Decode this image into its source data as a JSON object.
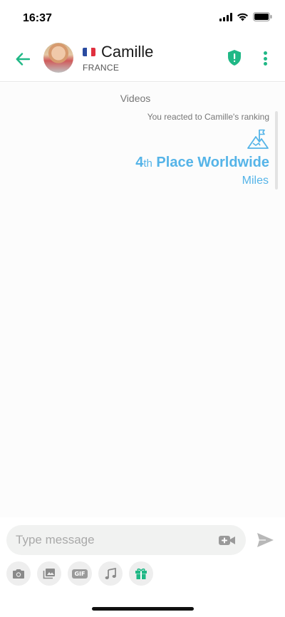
{
  "status_bar": {
    "time": "16:37",
    "icons": [
      "cellular-signal-icon",
      "wifi-icon",
      "battery-icon"
    ]
  },
  "header": {
    "back_icon": "arrow-left-icon",
    "contact_name": "Camille",
    "country": "FRANCE",
    "flag": "france-flag",
    "actions": [
      "shield-icon",
      "more-vertical-icon"
    ]
  },
  "chat": {
    "section_label": "Videos",
    "reaction_note": "You reacted to Camille's ranking",
    "ranking": {
      "icon": "mountain-flag-icon",
      "position_number": "4",
      "position_suffix": "th",
      "position_text": " Place Worldwide",
      "unit": "Miles"
    }
  },
  "composer": {
    "placeholder": "Type message",
    "value": "",
    "video_icon": "video-call-icon",
    "send_icon": "send-icon",
    "tools": [
      {
        "icon": "camera-icon"
      },
      {
        "icon": "gallery-icon"
      },
      {
        "icon": "gif-icon",
        "label": "GIF"
      },
      {
        "icon": "music-note-icon"
      },
      {
        "icon": "gift-icon"
      }
    ]
  },
  "colors": {
    "accent_green": "#20b886",
    "rank_blue": "#55b4e8",
    "input_bg": "#f1f2f1"
  }
}
